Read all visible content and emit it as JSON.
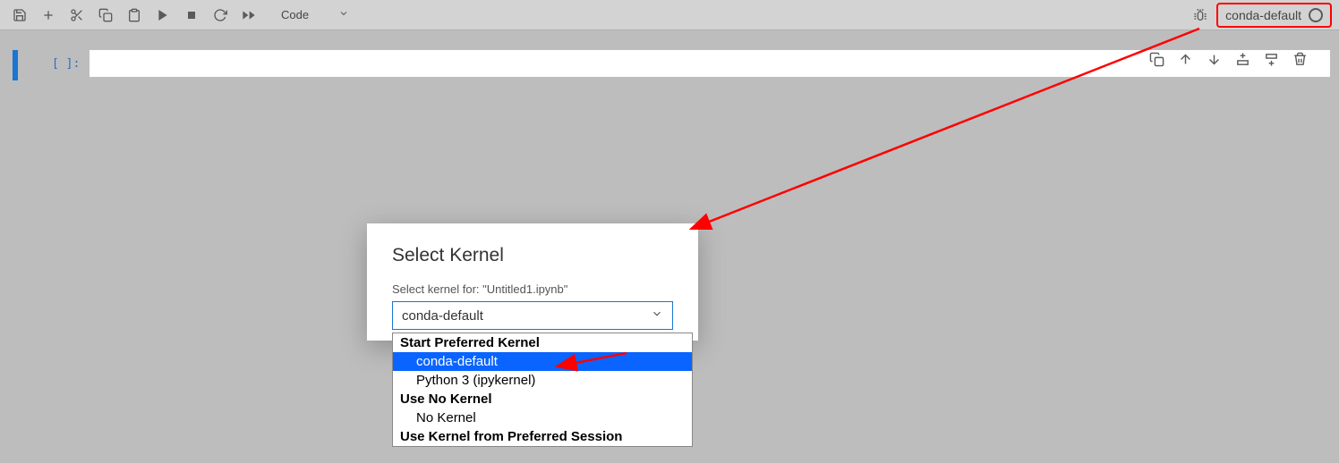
{
  "toolbar": {
    "cell_type": "Code",
    "kernel_name": "conda-default"
  },
  "cell": {
    "prompt": "[ ]:"
  },
  "dialog": {
    "title": "Select Kernel",
    "label": "Select kernel for: \"Untitled1.ipynb\"",
    "selected": "conda-default"
  },
  "dropdown": {
    "groups": [
      {
        "label": "Start Preferred Kernel",
        "items": [
          "conda-default",
          "Python 3 (ipykernel)"
        ]
      },
      {
        "label": "Use No Kernel",
        "items": [
          "No Kernel"
        ]
      },
      {
        "label": "Use Kernel from Preferred Session",
        "items": []
      }
    ],
    "highlighted": "conda-default"
  }
}
